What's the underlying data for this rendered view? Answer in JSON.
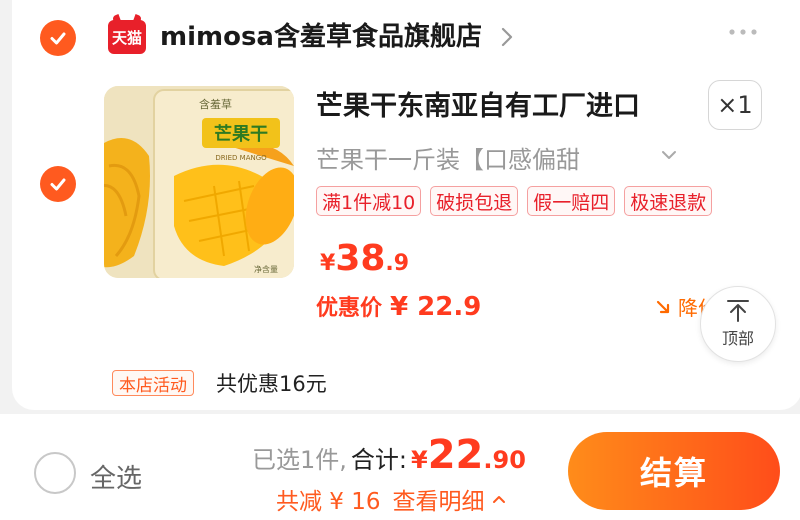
{
  "store": {
    "logo_text": "天猫",
    "name": "mimosa含羞草食品旗舰店"
  },
  "item": {
    "title": "芒果干东南亚自有工厂进口",
    "quantity": "×1",
    "variant": "芒果干一斤装【口感偏甜",
    "tags": [
      "满1件减10",
      "破损包退",
      "假一赔四",
      "极速退款"
    ],
    "price": {
      "yen": "¥",
      "int": "38",
      "dec": ".9"
    },
    "promo": {
      "label": "优惠价",
      "value": "¥ 22.9"
    },
    "price_drop": "降价",
    "image": {
      "brand_text": "含羞草",
      "pack_label": "芒果干",
      "pack_sub": "DRIED MANGO",
      "net_weight": "净含量"
    }
  },
  "back_to_top": {
    "label": "顶部"
  },
  "activity": {
    "badge": "本店活动",
    "text": "共优惠16元"
  },
  "footer": {
    "select_all": "全选",
    "selected": "已选1件,",
    "total_label": "合计:",
    "total": {
      "yen": "¥",
      "int": "22",
      "dec": ".90"
    },
    "discount": "共减 ¥ 16",
    "detail": "查看明细",
    "checkout": "结算"
  },
  "colors": {
    "accent": "#ff5a1f",
    "price": "#ff3b1f",
    "tmall_red": "#e8202a",
    "checkout_gradient": [
      "#ff8c1a",
      "#ff4d1a"
    ]
  }
}
